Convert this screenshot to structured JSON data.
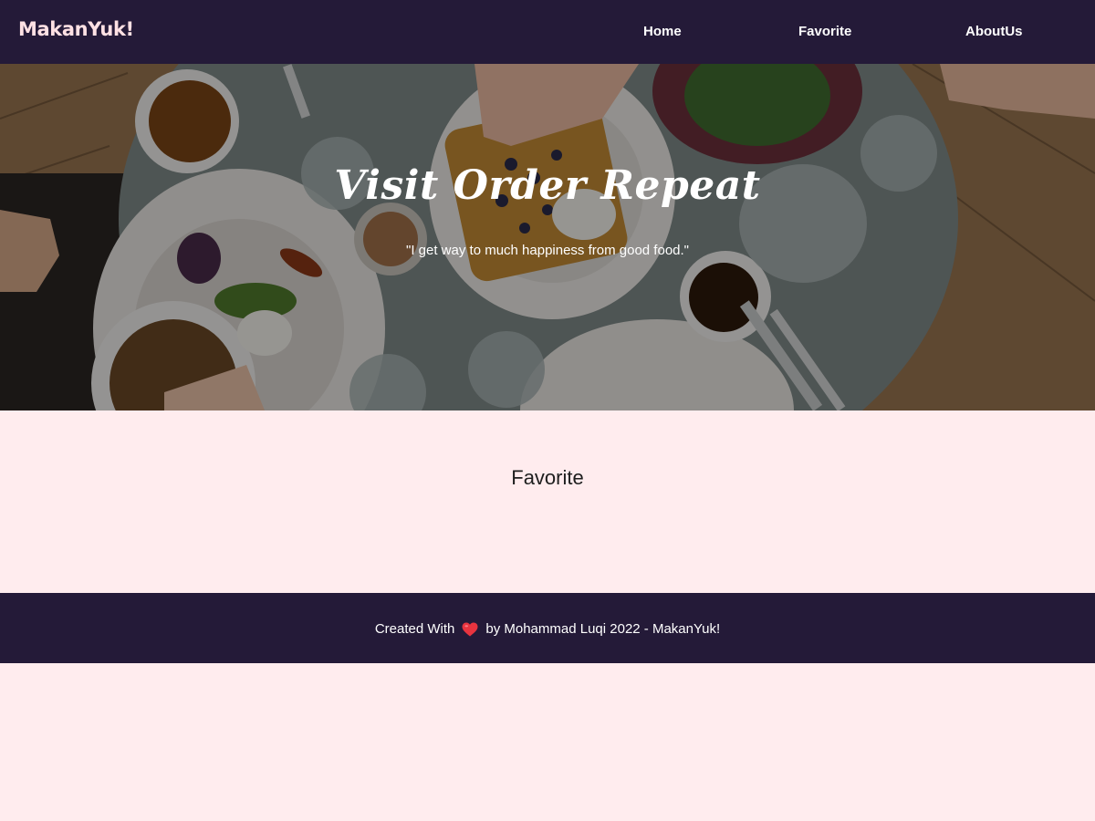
{
  "header": {
    "brand": "MakanYuk!",
    "nav": [
      {
        "label": "Home"
      },
      {
        "label": "Favorite"
      },
      {
        "label": "AboutUs"
      }
    ]
  },
  "hero": {
    "title": "Visit Order Repeat",
    "quote": "\"I get way to much happiness from good food.\""
  },
  "main": {
    "section_title": "Favorite"
  },
  "footer": {
    "prefix": "Created With",
    "icon": "heart-icon",
    "suffix": "by Mohammad Luqi 2022 - MakanYuk!"
  },
  "colors": {
    "header_bg": "#241a38",
    "page_bg": "#ffecee",
    "brand": "#ffe1e4",
    "heart": "#e8343f"
  }
}
